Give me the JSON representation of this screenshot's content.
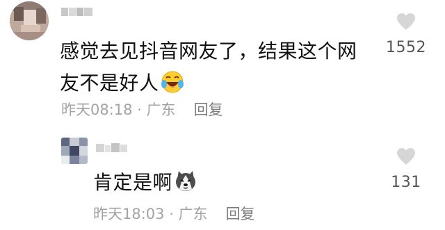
{
  "comments": [
    {
      "text": "感觉去见抖音网友了，结果这个网友不是好人",
      "emoji": "laughing-crying-emoji",
      "time": "昨天08:18",
      "separator": " · ",
      "location": "广东",
      "reply_label": "回复",
      "likes": "1552"
    }
  ],
  "reply": {
    "text": "肯定是啊",
    "emoji": "husky-dog-emoji",
    "time": "昨天18:03",
    "separator": " · ",
    "location": "广东",
    "reply_label": "回复",
    "likes": "131"
  },
  "icons": {
    "like": "heart-icon"
  },
  "colors": {
    "text": "#111111",
    "meta": "#a3a3a3",
    "heart": "#d6d6d6",
    "like_count": "#555555"
  }
}
